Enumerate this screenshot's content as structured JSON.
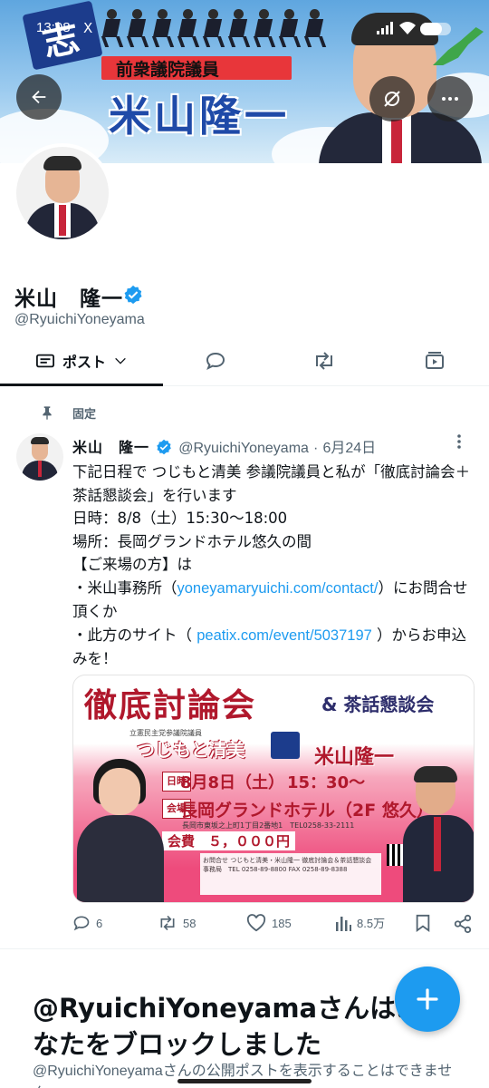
{
  "status_bar": {
    "time": "13:08",
    "notification": "X"
  },
  "banner": {
    "flag_char": "志",
    "subtitle": "前衆議院議員",
    "title": "米山隆一"
  },
  "profile": {
    "name": "米山　隆一",
    "handle": "@RyuichiYoneyama"
  },
  "tabs": {
    "posts_label": "ポスト"
  },
  "pinned_label": "固定",
  "post": {
    "author": "米山　隆一",
    "handle": "@RyuichiYoneyama",
    "separator": "·",
    "date": "6月24日",
    "text_before_link1": "下記日程で つじもと清美 参議院議員と私が「徹底討論会＋茶話懇談会」を行います\n日時：8/8（土）15:30〜18:00\n場所：長岡グランドホテル悠久の間\n【ご来場の方】は\n・米山事務所（",
    "link1": "yoneyamaryuichi.com/contact/",
    "text_between_links": "）にお問合せ頂くか\n・此方のサイト（ ",
    "link2": "peatix.com/event/5037197",
    "text_after_link2": " ）からお申込みを！",
    "stats": {
      "replies": "6",
      "reposts": "58",
      "likes": "185",
      "views": "8.5万"
    }
  },
  "flyer": {
    "title": "徹底討論会",
    "subtitle": "& 茶話懇談会",
    "small_caption": "立憲民主党参議院議員",
    "speaker1": "つじもと清美",
    "speaker2": "米山隆一",
    "date_label": "日時",
    "date": "8月8日（土）",
    "time": "15：30〜",
    "venue_label": "会場",
    "venue": "長岡グランドホテル（2F 悠久）",
    "address": "長岡市東坂之上町1丁目2番地1　TEL0258-33-2111",
    "fee": "会費　５，０００円",
    "contact": "お問合せ つじもと清美・米山隆一 徹底討論会＆茶話懇談会 事務局　TEL 0258-89-8800 FAX 0258-89-8388"
  },
  "blocked": {
    "title": "@RyuichiYoneyamaさんはあなたをブロックしました",
    "text": "@RyuichiYoneyamaさんの公開ポストを表示することはできません。"
  },
  "colors": {
    "accent": "#1d9bf0",
    "text": "#0f1419",
    "secondary": "#536471"
  }
}
